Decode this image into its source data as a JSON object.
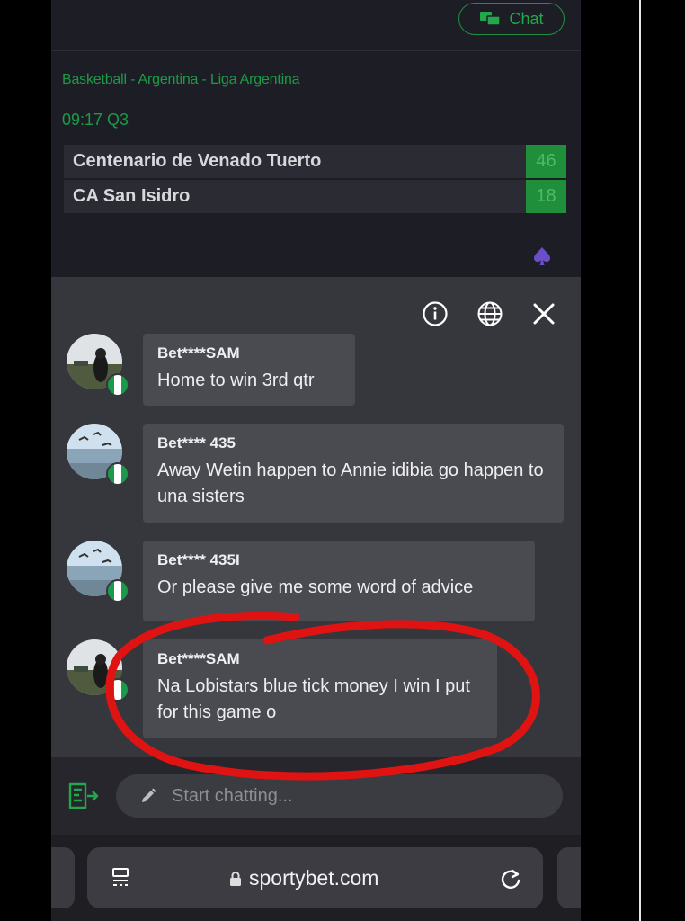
{
  "header": {
    "chat_button_label": "Chat"
  },
  "match": {
    "breadcrumb": "Basketball - Argentina - Liga Argentina",
    "time": "09:17 Q3",
    "teams": [
      {
        "name": "Centenario de Venado Tuerto",
        "score": "46"
      },
      {
        "name": "CA San Isidro",
        "score": "18"
      }
    ]
  },
  "chat_panel": {
    "icons": [
      "info-icon",
      "globe-icon",
      "close-icon"
    ],
    "messages": [
      {
        "user": "Bet****SAM",
        "text": "Home to win 3rd qtr"
      },
      {
        "user": "Bet**** 435",
        "text": "Away Wetin happen to Annie idibia go happen to una sisters"
      },
      {
        "user": "Bet**** 435I",
        "text": "Or please give me some word of advice"
      },
      {
        "user": "Bet****SAM",
        "text": "Na Lobistars blue tick money I win I put for this game o"
      }
    ]
  },
  "composer": {
    "placeholder": "Start chatting..."
  },
  "browser": {
    "url": "sportybet.com"
  },
  "colors": {
    "accent_green": "#1f8f3c",
    "annotation_red": "#e01313",
    "flag_green": "#1a9a4a"
  }
}
